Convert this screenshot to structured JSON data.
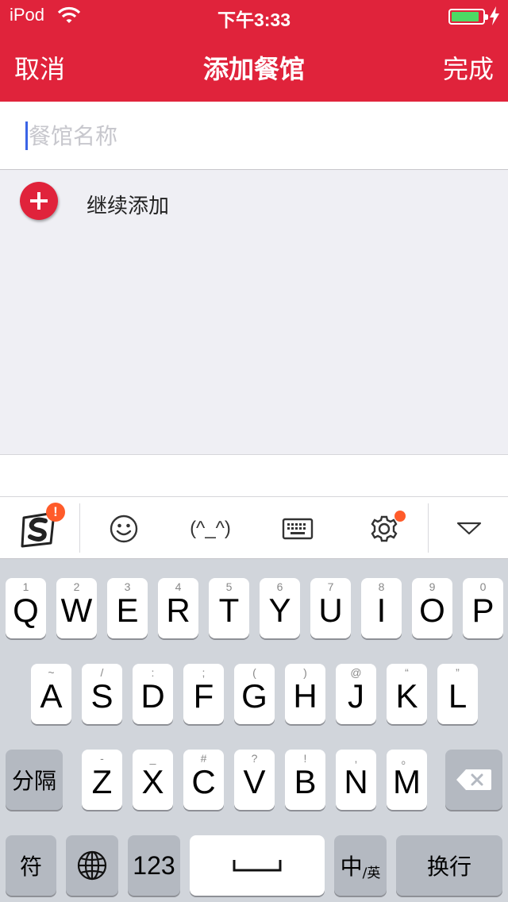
{
  "status_bar": {
    "carrier": "iPod",
    "time": "下午3:33",
    "battery_level": 0.9,
    "battery_color": "#4cd964"
  },
  "nav": {
    "cancel": "取消",
    "title": "添加餐馆",
    "done": "完成",
    "background": "#e0233b"
  },
  "form": {
    "name_placeholder": "餐馆名称",
    "name_value": ""
  },
  "add_more": {
    "label": "继续添加"
  },
  "ime_toolbar": {
    "items": [
      "sogou-logo-icon",
      "emoji-icon",
      "kaomoji",
      "keyboard-icon",
      "settings-icon",
      "collapse-icon"
    ],
    "alert_badge": "!",
    "kaomoji_text": "(^_^)"
  },
  "keyboard": {
    "row1": [
      {
        "label": "Q",
        "hint": "1"
      },
      {
        "label": "W",
        "hint": "2"
      },
      {
        "label": "E",
        "hint": "3"
      },
      {
        "label": "R",
        "hint": "4"
      },
      {
        "label": "T",
        "hint": "5"
      },
      {
        "label": "Y",
        "hint": "6"
      },
      {
        "label": "U",
        "hint": "7"
      },
      {
        "label": "I",
        "hint": "8"
      },
      {
        "label": "O",
        "hint": "9"
      },
      {
        "label": "P",
        "hint": "0"
      }
    ],
    "row2": [
      {
        "label": "A",
        "hint": "~"
      },
      {
        "label": "S",
        "hint": "/"
      },
      {
        "label": "D",
        "hint": ":"
      },
      {
        "label": "F",
        "hint": ";"
      },
      {
        "label": "G",
        "hint": "("
      },
      {
        "label": "H",
        "hint": ")"
      },
      {
        "label": "J",
        "hint": "@"
      },
      {
        "label": "K",
        "hint": "“"
      },
      {
        "label": "L",
        "hint": "”"
      }
    ],
    "row3": [
      {
        "label": "Z",
        "hint": "-"
      },
      {
        "label": "X",
        "hint": "_"
      },
      {
        "label": "C",
        "hint": "#"
      },
      {
        "label": "V",
        "hint": "?"
      },
      {
        "label": "B",
        "hint": "!"
      },
      {
        "label": "N",
        "hint": ","
      },
      {
        "label": "M",
        "hint": "。"
      }
    ],
    "separator_key": "分隔",
    "symbol_key": "符",
    "number_key": "123",
    "lang_key_main": "中",
    "lang_key_sub": "/英",
    "return_key": "换行"
  }
}
